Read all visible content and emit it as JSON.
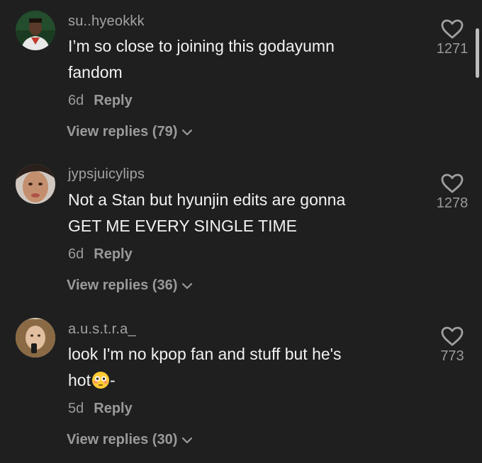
{
  "comments": [
    {
      "username": "su..hyeokkk",
      "line1": "I’m so close to joining this godayumn",
      "line2": "fandom",
      "age": "6d",
      "reply_label": "Reply",
      "view_replies": "View replies (79)",
      "likes": "1271",
      "avatar": "avatar-photo-man"
    },
    {
      "username": "jypsjuicylips",
      "line1": "Not a Stan but hyunjin edits are gonna",
      "line2": "GET ME EVERY SINGLE TIME",
      "age": "6d",
      "reply_label": "Reply",
      "view_replies": "View replies (36)",
      "likes": "1278",
      "avatar": "avatar-photo-face"
    },
    {
      "username": "a.u.s.t.r.a_",
      "line1": "look I'm no kpop fan and stuff but he's",
      "line2": "hot",
      "line2_suffix": "-",
      "age": "5d",
      "reply_label": "Reply",
      "view_replies": "View replies (30)",
      "likes": "773",
      "avatar": "avatar-photo-girl"
    }
  ],
  "colors": {
    "background": "#1f1f1f",
    "primary_text": "#f2f2f2",
    "secondary_text": "#9a9a9a"
  },
  "icons": [
    "heart-outline-icon",
    "chevron-down-icon",
    "flushed-face-emoji"
  ]
}
